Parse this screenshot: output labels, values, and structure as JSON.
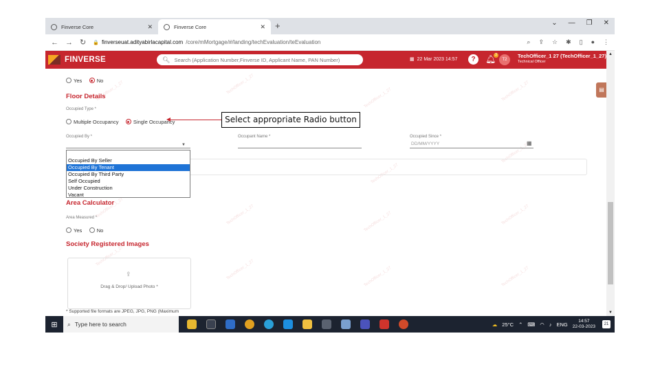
{
  "browser": {
    "tabs": [
      {
        "title": "Finverse Core",
        "active": false
      },
      {
        "title": "Finverse Core",
        "active": true
      }
    ],
    "url_domain": "finverseuat.adityabirlacapital.com",
    "url_path": "/core/mMortgage/#/landing/techEvaluation/teEvaluation"
  },
  "header": {
    "brand": "FINVERSE",
    "search_placeholder": "Search (Application Number,Finverse ID, Applicant Name, PAN Number)",
    "date": "22 Mar 2023 14:57",
    "help": "?",
    "notification_count": "3",
    "avatar_initials": "T2",
    "user_name": "TechOfficer_1 27 (TechOfficer_1_27)",
    "user_role": "Technical Officer"
  },
  "top_radio": {
    "options": [
      "Yes",
      "No"
    ],
    "selected": "No"
  },
  "floor": {
    "title": "Floor Details",
    "occupied_type_label": "Occupied Type *",
    "occupied_type_options": [
      "Multiple Occupancy",
      "Single Occupancy"
    ],
    "occupied_type_selected": "Single Occupancy",
    "occupied_by_label": "Occupied By *",
    "occupant_name_label": "Occupant Name *",
    "occupied_since_label": "Occupied Since *",
    "occupied_since_placeholder": "DD/MM/YYYY"
  },
  "dropdown": {
    "options": [
      "Occupied By Seller",
      "Occupied By Tenant",
      "Occupied By Third Party",
      "Self Occupied",
      "Under Construction",
      "Vacant"
    ],
    "highlighted": "Occupied By Tenant"
  },
  "area": {
    "title": "Area Calculator",
    "measured_label": "Area Measured *",
    "options": [
      "Yes",
      "No"
    ]
  },
  "society": {
    "title": "Society Registered Images",
    "upload_text": "Drag & Drop/ Upload Photo *",
    "note": "* Supported file formats are JPEG, JPG, PNG (Maximum"
  },
  "annotation": {
    "callout": "Select appropriate Radio button"
  },
  "watermark_text": "TechOfficer_1_27",
  "taskbar": {
    "search_placeholder": "Type here to search",
    "temperature": "25°C",
    "language": "ENG",
    "time": "14:57",
    "date": "22-03-2023",
    "notif_badge": "21"
  }
}
